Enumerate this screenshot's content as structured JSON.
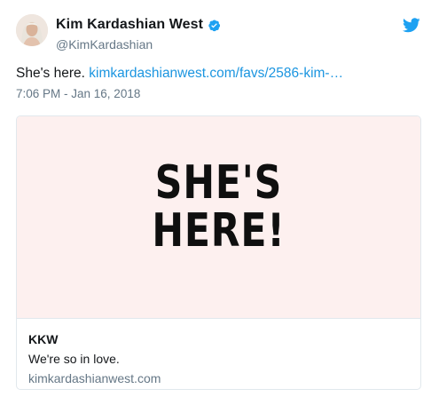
{
  "user": {
    "display_name": "Kim Kardashian West",
    "handle": "@KimKardashian",
    "verified": true
  },
  "tweet": {
    "text": "She's here.",
    "link_text": "kimkardashianwest.com/favs/2586-kim-…",
    "timestamp": "7:06 PM - Jan 16, 2018"
  },
  "card": {
    "image_line1": "SHE'S",
    "image_line2": "HERE!",
    "title": "KKW",
    "description": "We're so in love.",
    "domain": "kimkardashianwest.com"
  },
  "colors": {
    "link": "#1b95e0",
    "verified_badge": "#1da1f2",
    "twitter_bird": "#1da1f2",
    "card_image_bg": "#fdf0ef"
  },
  "icons": {
    "verified": "verified-badge-icon",
    "brand": "twitter-bird-icon"
  }
}
